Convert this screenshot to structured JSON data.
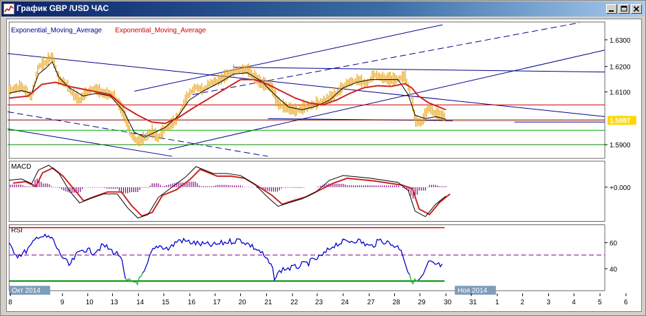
{
  "window": {
    "title": "График GBP /USD ЧАС",
    "buttons": [
      "minimize",
      "maximize",
      "close"
    ]
  },
  "main_panel": {
    "legend": [
      {
        "text": "Exponential_Moving_Average",
        "color": "#00008b"
      },
      {
        "text": "Exponential_Moving_Average",
        "color": "#cc0000"
      }
    ],
    "price_labels": [
      "1.6300",
      "1.6200",
      "1.6100",
      "1.5900"
    ],
    "current_price": "1.5987",
    "current_price_bg": "#ffd700"
  },
  "macd_panel": {
    "label": "MACD",
    "zero_label": "+0.000"
  },
  "rsi_panel": {
    "label": "RSI",
    "levels": [
      "60",
      "40"
    ]
  },
  "date_axis": {
    "ticks": [
      "8",
      "9",
      "10",
      "13",
      "14",
      "15",
      "16",
      "17",
      "20",
      "21",
      "22",
      "23",
      "24",
      "27",
      "28",
      "29",
      "30",
      "31",
      "1",
      "2",
      "3",
      "4",
      "5",
      "6"
    ],
    "month_labels": [
      "Окт 2014",
      "Ноя 2014"
    ]
  },
  "colors": {
    "price_bars": "#e8a317",
    "ema_fast": "#000000",
    "ema_slow": "#cc2222",
    "trendlines": "#00008b",
    "macd_hist": "#800080",
    "rsi_line": "#0000cc",
    "rsi_oversold": "#33cc33",
    "upper_level": "#e00000",
    "lower_level": "#008800"
  }
}
